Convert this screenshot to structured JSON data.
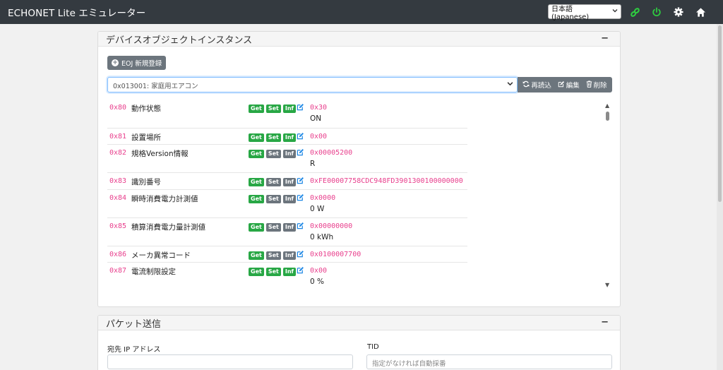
{
  "app": {
    "title": "ECHONET Lite エミュレーター"
  },
  "nav": {
    "language": "日本語 (Japanese)",
    "link_icon": "link-icon",
    "power_icon": "power-icon",
    "settings_icon": "gear-icon",
    "home_icon": "home-icon"
  },
  "device_panel": {
    "title": "デバイスオブジェクトインスタンス",
    "collapse": "−",
    "new_eoj_button": "EOJ 新規登録",
    "selected_eoj": "0x013001: 家庭用エアコン",
    "reload_label": "再読込",
    "edit_label": "編集",
    "delete_label": "削除"
  },
  "properties": [
    {
      "epc": "0x80",
      "name": "動作状態",
      "get": "Get",
      "set": "Set",
      "inf": "Inf",
      "get_on": true,
      "set_on": true,
      "inf_on": true,
      "value": "0x30",
      "decoded": "ON"
    },
    {
      "epc": "0x81",
      "name": "設置場所",
      "get": "Get",
      "set": "Set",
      "inf": "Inf",
      "get_on": true,
      "set_on": true,
      "inf_on": true,
      "value": "0x00",
      "decoded": ""
    },
    {
      "epc": "0x82",
      "name": "規格Version情報",
      "get": "Get",
      "set": "Set",
      "inf": "Inf",
      "get_on": true,
      "set_on": false,
      "inf_on": false,
      "value": "0x00005200",
      "decoded": "R"
    },
    {
      "epc": "0x83",
      "name": "識別番号",
      "get": "Get",
      "set": "Set",
      "inf": "Inf",
      "get_on": true,
      "set_on": false,
      "inf_on": false,
      "value": "0xFE00007758CDC948FD3901300100000000",
      "decoded": ""
    },
    {
      "epc": "0x84",
      "name": "瞬時消費電力計測値",
      "get": "Get",
      "set": "Set",
      "inf": "Inf",
      "get_on": true,
      "set_on": false,
      "inf_on": false,
      "value": "0x0000",
      "decoded": "0 W"
    },
    {
      "epc": "0x85",
      "name": "積算消費電力量計測値",
      "get": "Get",
      "set": "Set",
      "inf": "Inf",
      "get_on": true,
      "set_on": false,
      "inf_on": false,
      "value": "0x00000000",
      "decoded": "0 kWh"
    },
    {
      "epc": "0x86",
      "name": "メーカ異常コード",
      "get": "Get",
      "set": "Set",
      "inf": "Inf",
      "get_on": true,
      "set_on": false,
      "inf_on": false,
      "value": "0x0100007700",
      "decoded": ""
    },
    {
      "epc": "0x87",
      "name": "電流制限設定",
      "get": "Get",
      "set": "Set",
      "inf": "Inf",
      "get_on": true,
      "set_on": true,
      "inf_on": true,
      "value": "0x00",
      "decoded": "0 %"
    }
  ],
  "packet_panel": {
    "title": "パケット送信",
    "collapse": "−",
    "dest_label": "宛先 IP アドレス",
    "dest_value": "",
    "tid_label": "TID",
    "tid_placeholder": "指定がなければ自動採番"
  },
  "colors": {
    "navbar": "#343a40",
    "accent_green": "#28a745",
    "epc_pink": "#e83e8c",
    "badge_gray": "#6c757d",
    "focus_blue": "#80bdff"
  }
}
